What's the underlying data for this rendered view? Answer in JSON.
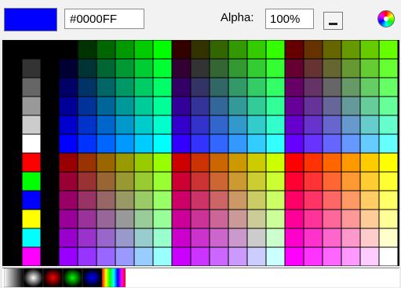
{
  "current_color": "#0000FF",
  "hex_value": "#0000FF",
  "alpha_label": "Alpha:",
  "alpha_value": "100%",
  "grays": [
    "#333333",
    "#666666",
    "#999999",
    "#CCCCCC",
    "#FFFFFF"
  ],
  "primaries": [
    "#FF0000",
    "#00FF00",
    "#0000FF",
    "#FFFF00",
    "#00FFFF",
    "#FF00FF"
  ],
  "gradients": [
    {
      "name": "gradient-linear-black-white",
      "stops": [
        "#ffffff",
        "#000000"
      ],
      "kind": "linear"
    },
    {
      "name": "gradient-radial-white-black",
      "stops": [
        "#ffffff",
        "#000000"
      ],
      "kind": "radial"
    },
    {
      "name": "gradient-radial-red",
      "stops": [
        "#ff0000",
        "#000000"
      ],
      "kind": "radial"
    },
    {
      "name": "gradient-radial-green",
      "stops": [
        "#00ff00",
        "#000000"
      ],
      "kind": "radial"
    },
    {
      "name": "gradient-radial-blue",
      "stops": [
        "#0000ff",
        "#000000"
      ],
      "kind": "radial"
    },
    {
      "name": "gradient-linear-spectrum",
      "stops": [
        "#ff0000",
        "#ffff00",
        "#00ff00",
        "#00ffff",
        "#0000ff",
        "#ff00ff",
        "#ff0000"
      ],
      "kind": "linear"
    }
  ]
}
